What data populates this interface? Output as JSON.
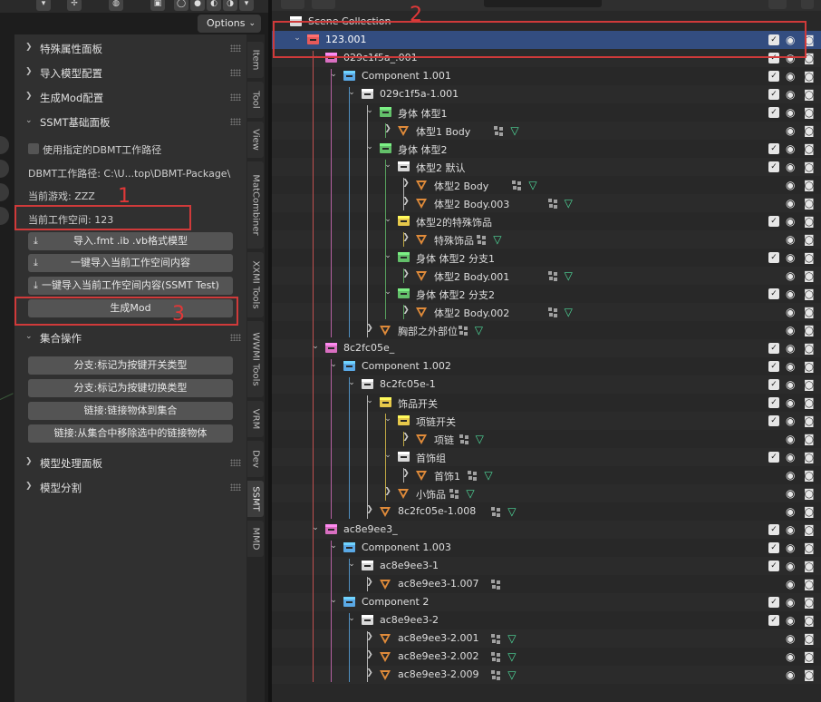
{
  "toolbar": {
    "options_label": "Options"
  },
  "panel": {
    "headers": [
      {
        "label": "特殊属性面板",
        "open": false
      },
      {
        "label": "导入模型配置",
        "open": false
      },
      {
        "label": "生成Mod配置",
        "open": false
      },
      {
        "label": "SSMT基础面板",
        "open": true
      },
      {
        "label": "集合操作",
        "open": true
      },
      {
        "label": "模型处理面板",
        "open": false
      },
      {
        "label": "模型分割",
        "open": false
      }
    ],
    "dbmt_checkbox_label": "使用指定的DBMT工作路径",
    "dbmt_path": "DBMT工作路径: C:\\U...top\\DBMT-Package\\",
    "current_game": "当前游戏: ZZZ",
    "current_workspace": "当前工作空间: 123",
    "buttons": {
      "import_fmt": "导入.fmt .ib .vb格式模型",
      "import_workspace": "一键导入当前工作空间内容",
      "import_workspace_ssmt": "一键导入当前工作空间内容(SSMT Test)",
      "generate_mod": "生成Mod",
      "branch_toggle": "分支:标记为按键开关类型",
      "branch_switch": "分支:标记为按键切换类型",
      "link_objects": "链接:链接物体到集合",
      "unlink_objects": "链接:从集合中移除选中的链接物体"
    }
  },
  "annotations": {
    "one": "1",
    "two": "2",
    "three": "3"
  },
  "tabs": [
    "Item",
    "Tool",
    "View",
    "MatCombiner",
    "XXMI Tools",
    "WWMI Tools",
    "VRM",
    "Dev",
    "SSMT",
    "MMD"
  ],
  "active_tab": "SSMT",
  "outliner": {
    "scene_collection": "Scene Collection",
    "colors": {
      "pink": "#d96fc1",
      "blue": "#5aa9e6",
      "white": "#d8d8d8",
      "green": "#63c06a",
      "yellow": "#e6c84a",
      "red": "#e65a5a",
      "object": "#e08b3a",
      "mesh": "#4fdc9c"
    },
    "rows": [
      {
        "name": "123.001",
        "kind": "coll",
        "color": "red",
        "depth": 0,
        "exp": "open",
        "sel": true,
        "chk": true
      },
      {
        "name": "029c1f5a_.001",
        "kind": "coll",
        "color": "pink",
        "depth": 1,
        "exp": "open",
        "chk": true
      },
      {
        "name": "Component 1.001",
        "kind": "coll",
        "color": "blue",
        "depth": 2,
        "exp": "open",
        "chk": true
      },
      {
        "name": "029c1f5a-1.001",
        "kind": "coll",
        "color": "white",
        "depth": 3,
        "exp": "open",
        "chk": true
      },
      {
        "name": "身体 体型1",
        "kind": "coll",
        "color": "green",
        "depth": 4,
        "exp": "open",
        "chk": true
      },
      {
        "name": "体型1 Body",
        "kind": "obj",
        "depth": 5,
        "exp": "closed",
        "mods": true
      },
      {
        "name": "身体 体型2",
        "kind": "coll",
        "color": "green",
        "depth": 4,
        "exp": "open",
        "chk": true
      },
      {
        "name": "体型2 默认",
        "kind": "coll",
        "color": "white",
        "depth": 5,
        "exp": "open",
        "chk": true
      },
      {
        "name": "体型2 Body",
        "kind": "obj",
        "depth": 6,
        "exp": "closed",
        "mods": true
      },
      {
        "name": "体型2 Body.003",
        "kind": "obj",
        "depth": 6,
        "exp": "closed",
        "mods": true
      },
      {
        "name": "体型2的特殊饰品",
        "kind": "coll",
        "color": "yellow",
        "depth": 5,
        "exp": "open",
        "chk": true
      },
      {
        "name": "特殊饰品",
        "kind": "obj",
        "depth": 6,
        "exp": "closed",
        "mods": true
      },
      {
        "name": "身体 体型2 分支1",
        "kind": "coll",
        "color": "green",
        "depth": 5,
        "exp": "open",
        "chk": true
      },
      {
        "name": "体型2 Body.001",
        "kind": "obj",
        "depth": 6,
        "exp": "closed",
        "mods": true
      },
      {
        "name": "身体 体型2 分支2",
        "kind": "coll",
        "color": "green",
        "depth": 5,
        "exp": "open",
        "chk": true
      },
      {
        "name": "体型2 Body.002",
        "kind": "obj",
        "depth": 6,
        "exp": "closed",
        "mods": true
      },
      {
        "name": "胸部之外部位",
        "kind": "obj",
        "depth": 4,
        "exp": "closed",
        "mods": true
      },
      {
        "name": "8c2fc05e_",
        "kind": "coll",
        "color": "pink",
        "depth": 1,
        "exp": "open",
        "chk": true
      },
      {
        "name": "Component 1.002",
        "kind": "coll",
        "color": "blue",
        "depth": 2,
        "exp": "open",
        "chk": true
      },
      {
        "name": "8c2fc05e-1",
        "kind": "coll",
        "color": "white",
        "depth": 3,
        "exp": "open",
        "chk": true
      },
      {
        "name": "饰品开关",
        "kind": "coll",
        "color": "yellow",
        "depth": 4,
        "exp": "open",
        "chk": true
      },
      {
        "name": "项链开关",
        "kind": "coll",
        "color": "yellow",
        "depth": 5,
        "exp": "open",
        "chk": true
      },
      {
        "name": "项链",
        "kind": "obj",
        "depth": 6,
        "exp": "closed",
        "mods": true
      },
      {
        "name": "首饰组",
        "kind": "coll",
        "color": "white",
        "depth": 5,
        "exp": "open",
        "chk": true
      },
      {
        "name": "首饰1",
        "kind": "obj",
        "depth": 6,
        "exp": "closed",
        "mods": true
      },
      {
        "name": "小饰品",
        "kind": "obj",
        "depth": 5,
        "exp": "closed",
        "mods": true
      },
      {
        "name": "8c2fc05e-1.008",
        "kind": "obj",
        "depth": 4,
        "exp": "closed",
        "mods": true
      },
      {
        "name": "ac8e9ee3_",
        "kind": "coll",
        "color": "pink",
        "depth": 1,
        "exp": "open",
        "chk": true
      },
      {
        "name": "Component 1.003",
        "kind": "coll",
        "color": "blue",
        "depth": 2,
        "exp": "open",
        "chk": true
      },
      {
        "name": "ac8e9ee3-1",
        "kind": "coll",
        "color": "white",
        "depth": 3,
        "exp": "open",
        "chk": true
      },
      {
        "name": "ac8e9ee3-1.007",
        "kind": "obj",
        "depth": 4,
        "exp": "closed",
        "mods": false
      },
      {
        "name": "Component 2",
        "kind": "coll",
        "color": "blue",
        "depth": 2,
        "exp": "open",
        "chk": true
      },
      {
        "name": "ac8e9ee3-2",
        "kind": "coll",
        "color": "white",
        "depth": 3,
        "exp": "open",
        "chk": true
      },
      {
        "name": "ac8e9ee3-2.001",
        "kind": "obj",
        "depth": 4,
        "exp": "closed",
        "mods": true
      },
      {
        "name": "ac8e9ee3-2.002",
        "kind": "obj",
        "depth": 4,
        "exp": "closed",
        "mods": true
      },
      {
        "name": "ac8e9ee3-2.009",
        "kind": "obj",
        "depth": 4,
        "exp": "closed",
        "mods": true
      }
    ]
  }
}
